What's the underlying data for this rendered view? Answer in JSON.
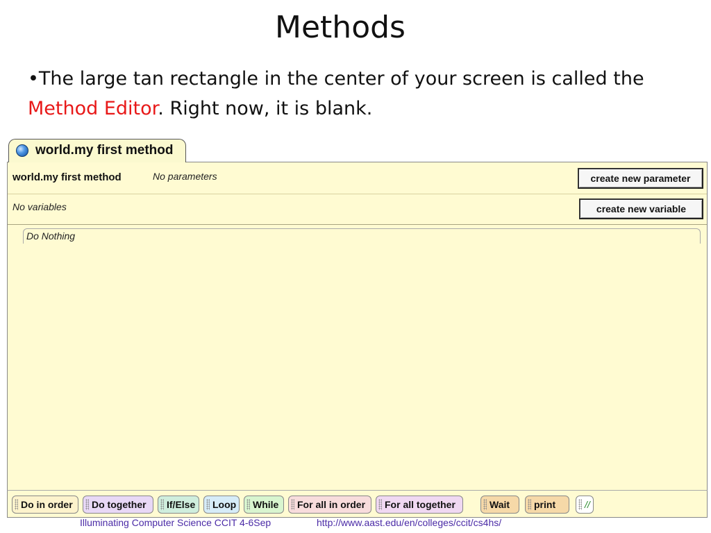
{
  "slide": {
    "title": "Methods",
    "bullet_prefix": "•The large tan rectangle in the center of your screen is called the ",
    "bullet_highlight": "Method Editor",
    "bullet_suffix": ". Right now, it is blank.",
    "highlight_color": "#e81818"
  },
  "editor": {
    "tab_label": "world.my first method",
    "tab_icon": "globe-icon",
    "method_name": "world.my first method",
    "parameters_text": "No parameters",
    "variables_text": "No variables",
    "create_parameter_label": "create new parameter",
    "create_variable_label": "create new variable",
    "body_statement": "Do Nothing",
    "background_color": "#fffbd2"
  },
  "palette": {
    "items": [
      {
        "label": "Do in order",
        "color": "#fdf3cc"
      },
      {
        "label": "Do together",
        "color": "#e8d8f6"
      },
      {
        "label": "If/Else",
        "color": "#cfeedd"
      },
      {
        "label": "Loop",
        "color": "#d6ecf8"
      },
      {
        "label": "While",
        "color": "#d8f5cf"
      },
      {
        "label": "For all in order",
        "color": "#f8dcdc"
      },
      {
        "label": "For all together",
        "color": "#f0d8f2"
      },
      {
        "label": "Wait",
        "color": "#f6d9a8"
      },
      {
        "label": "print",
        "color": "#f6d9a8"
      },
      {
        "label": "//",
        "color": "#ffffff"
      }
    ]
  },
  "footer": {
    "left_text": "Illuminating Computer Science CCIT 4-6Sep",
    "url_text": "http://www.aast.edu/en/colleges/ccit/cs4hs/"
  }
}
